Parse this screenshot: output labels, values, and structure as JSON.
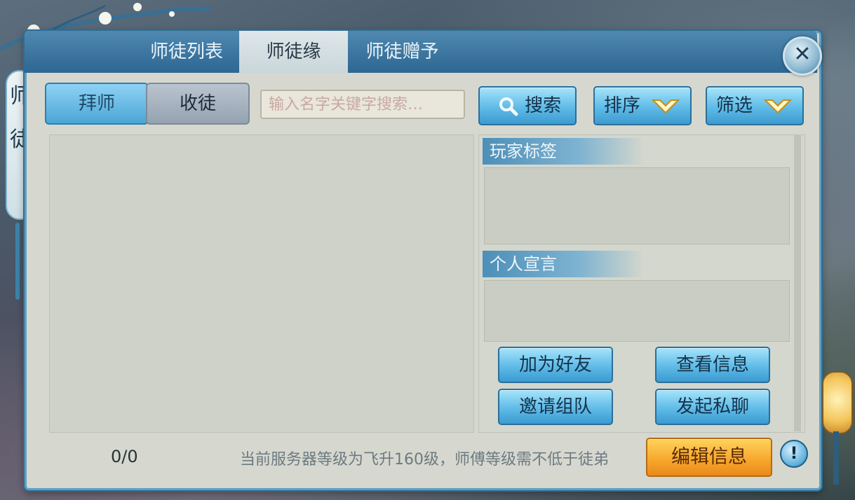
{
  "tabs": [
    {
      "label": "师徒列表",
      "active": false
    },
    {
      "label": "师徒缘",
      "active": true
    },
    {
      "label": "师徒赠予",
      "active": false
    }
  ],
  "side_title": [
    "师",
    "徒"
  ],
  "segment": {
    "left": "拜师",
    "right": "收徒"
  },
  "search": {
    "placeholder": "输入名字关键字搜索…",
    "button_label": "搜索"
  },
  "sort_label": "排序",
  "filter_label": "筛选",
  "detail": {
    "tags_title": "玩家标签",
    "manifesto_title": "个人宣言"
  },
  "actions": {
    "add_friend": "加为好友",
    "view_info": "查看信息",
    "invite_team": "邀请组队",
    "private_chat": "发起私聊"
  },
  "footer": {
    "count": "0/0",
    "notice": "当前服务器等级为飞升160级，师傅等级需不低于徒弟",
    "edit_label": "编辑信息",
    "info_icon": "!"
  },
  "close_label": "✕"
}
